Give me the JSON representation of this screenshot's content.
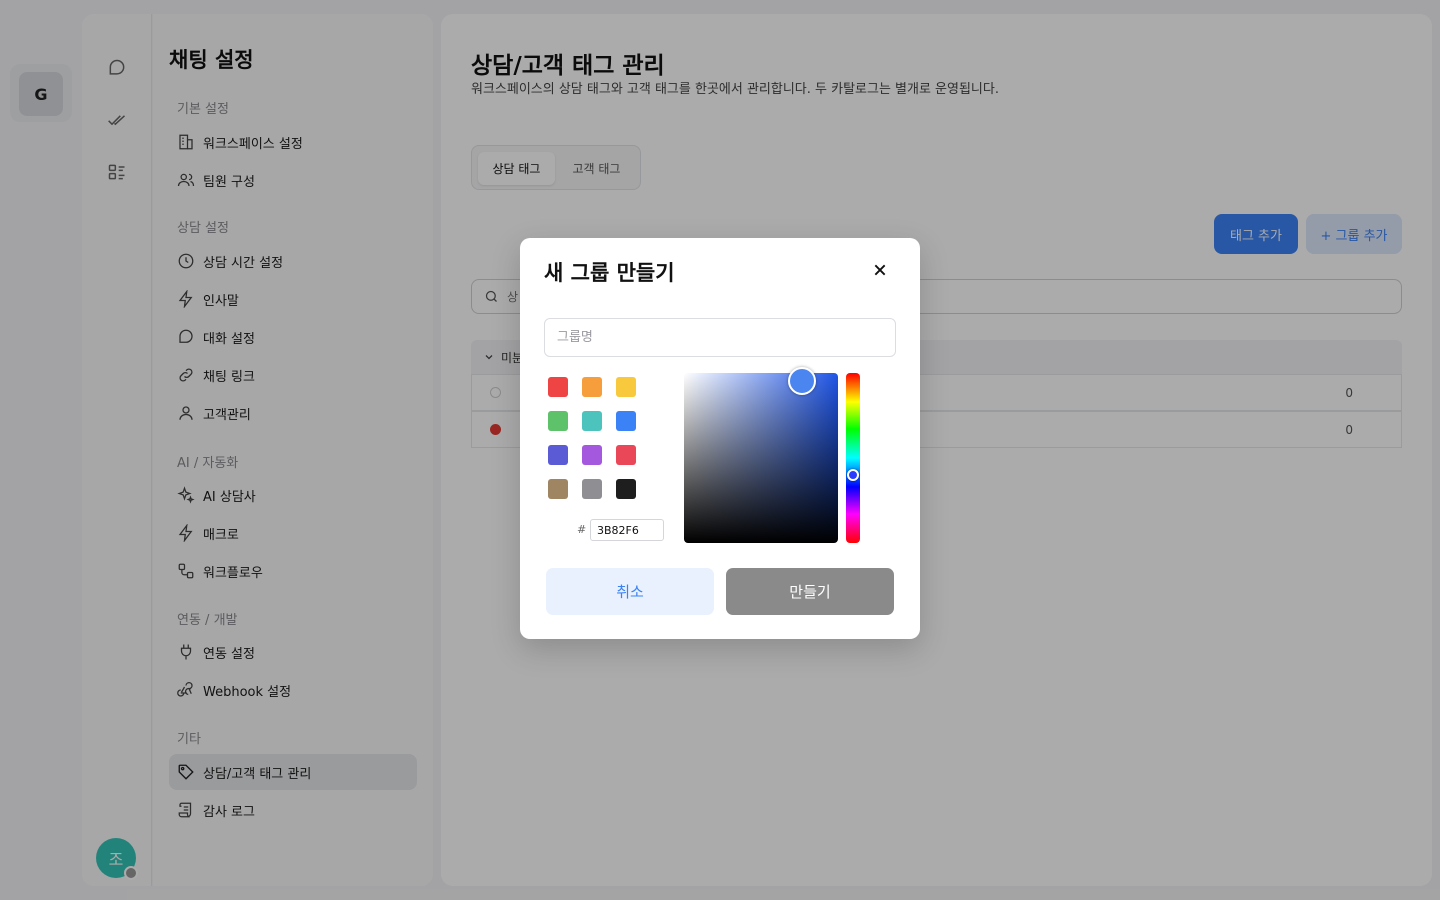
{
  "workspace": {
    "initial": "G"
  },
  "user": {
    "initial": "조"
  },
  "sidebar": {
    "title": "채팅 설정",
    "groups": [
      {
        "label": "기본 설정",
        "items": [
          {
            "label": "워크스페이스 설정",
            "icon": "building-icon"
          },
          {
            "label": "팀원 구성",
            "icon": "users-icon"
          }
        ]
      },
      {
        "label": "상담 설정",
        "items": [
          {
            "label": "상담 시간 설정",
            "icon": "clock-icon"
          },
          {
            "label": "인사말",
            "icon": "lightning-icon"
          },
          {
            "label": "대화 설정",
            "icon": "chat-bubble-icon"
          },
          {
            "label": "채팅 링크",
            "icon": "link-icon"
          },
          {
            "label": "고객관리",
            "icon": "user-icon"
          }
        ]
      },
      {
        "label": "AI / 자동화",
        "items": [
          {
            "label": "AI 상담사",
            "icon": "sparkles-icon"
          },
          {
            "label": "매크로",
            "icon": "lightning-icon"
          },
          {
            "label": "워크플로우",
            "icon": "workflow-icon"
          }
        ]
      },
      {
        "label": "연동 / 개발",
        "items": [
          {
            "label": "연동 설정",
            "icon": "plug-icon"
          },
          {
            "label": "Webhook 설정",
            "icon": "webhook-icon"
          }
        ]
      },
      {
        "label": "기타",
        "items": [
          {
            "label": "상담/고객 태그 관리",
            "icon": "tag-icon",
            "active": true
          },
          {
            "label": "감사 로그",
            "icon": "scroll-icon"
          }
        ]
      }
    ]
  },
  "page": {
    "title": "상담/고객 태그 관리",
    "description": "워크스페이스의 상담 태그와 고객 태그를 한곳에서 관리합니다. 두 카탈로그는 별개로 운영됩니다.",
    "tabs": [
      {
        "label": "상담 태그",
        "active": true
      },
      {
        "label": "고객 태그",
        "active": false
      }
    ],
    "add_tag_label": "태그 추가",
    "add_group_label": "+ 그룹 추가",
    "search_placeholder": "상",
    "group_name": "미분",
    "tag_rows": [
      {
        "color": "#ffffff",
        "count": "0"
      },
      {
        "color": "#e53935",
        "count": "0"
      }
    ]
  },
  "modal": {
    "title": "새 그룹 만들기",
    "name_placeholder": "그룹명",
    "swatches": [
      "#ef4444",
      "#f59e3b",
      "#f8c93c",
      "#5dc26a",
      "#4cc4bd",
      "#3b82f6",
      "#5b5bd6",
      "#a458dd",
      "#ea4759",
      "#a08562",
      "#8e8e93",
      "#1e1e1e"
    ],
    "hex_prefix": "#",
    "hex_value": "3B82F6",
    "cancel_label": "취소",
    "create_label": "만들기"
  }
}
